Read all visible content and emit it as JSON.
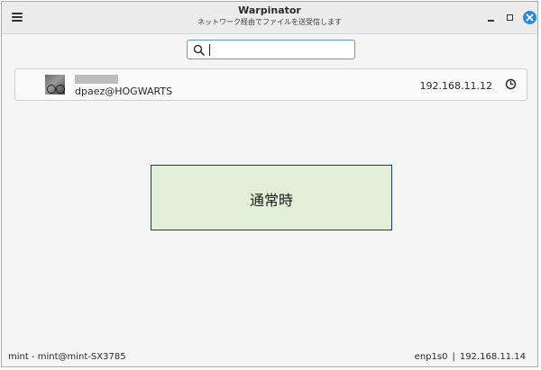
{
  "window": {
    "title": "Warpinator",
    "subtitle": "ネットワーク経由でファイルを送受信します"
  },
  "search": {
    "placeholder": "",
    "value": ""
  },
  "devices": [
    {
      "display_name_redacted": true,
      "user_host": "dpaez@HOGWARTS",
      "ip": "192.168.11.12",
      "status_icon": "clock-icon"
    }
  ],
  "overlay": {
    "label": "通常時"
  },
  "statusbar": {
    "left": "mint - mint@mint-SX3785",
    "interface": "enp1s0",
    "separator": "|",
    "ip": "192.168.11.14"
  },
  "colors": {
    "accent": "#2b8ad6",
    "search_border": "#5b9bd5",
    "overlay_fill": "#e2efd9",
    "overlay_border": "#1f3864"
  }
}
